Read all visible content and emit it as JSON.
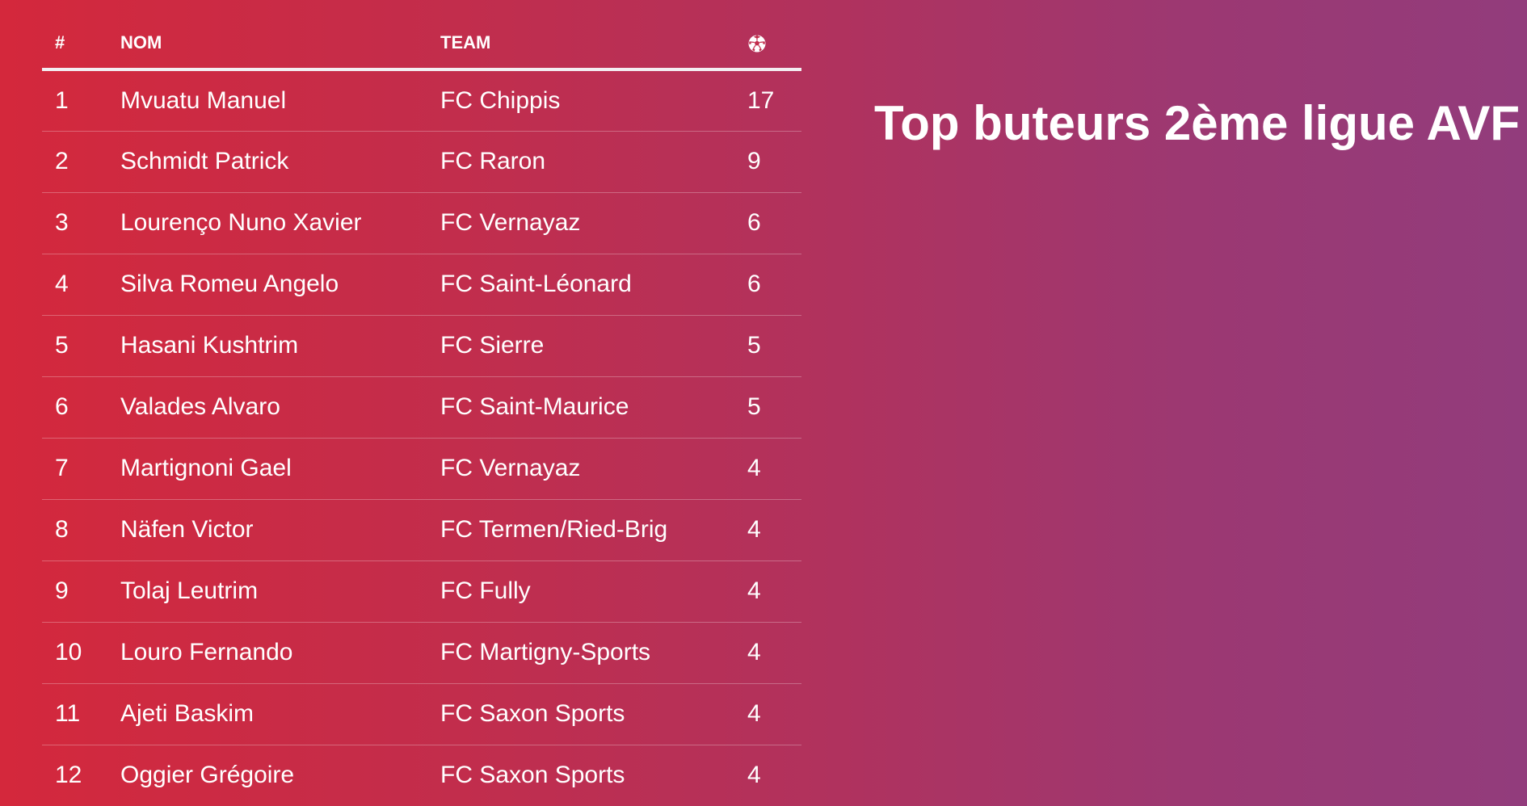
{
  "title": "Top buteurs 2ème ligue AVF",
  "table": {
    "headers": {
      "rank": "#",
      "name": "NOM",
      "team": "TEAM",
      "goals_icon": "soccer-ball-icon"
    },
    "rows": [
      {
        "rank": "1",
        "name": "Mvuatu Manuel",
        "team": "FC Chippis",
        "goals": "17"
      },
      {
        "rank": "2",
        "name": "Schmidt Patrick",
        "team": "FC Raron",
        "goals": "9"
      },
      {
        "rank": "3",
        "name": "Lourenço Nuno Xavier",
        "team": "FC Vernayaz",
        "goals": "6"
      },
      {
        "rank": "4",
        "name": "Silva Romeu Angelo",
        "team": "FC Saint-Léonard",
        "goals": "6"
      },
      {
        "rank": "5",
        "name": "Hasani Kushtrim",
        "team": "FC Sierre",
        "goals": "5"
      },
      {
        "rank": "6",
        "name": "Valades Alvaro",
        "team": "FC Saint-Maurice",
        "goals": "5"
      },
      {
        "rank": "7",
        "name": "Martignoni Gael",
        "team": "FC Vernayaz",
        "goals": "4"
      },
      {
        "rank": "8",
        "name": "Näfen Victor",
        "team": "FC Termen/Ried-Brig",
        "goals": "4"
      },
      {
        "rank": "9",
        "name": "Tolaj Leutrim",
        "team": "FC Fully",
        "goals": "4"
      },
      {
        "rank": "10",
        "name": "Louro Fernando",
        "team": "FC Martigny-Sports",
        "goals": "4"
      },
      {
        "rank": "11",
        "name": "Ajeti Baskim",
        "team": "FC Saxon Sports",
        "goals": "4"
      },
      {
        "rank": "12",
        "name": "Oggier Grégoire",
        "team": "FC Saxon Sports",
        "goals": "4"
      }
    ]
  },
  "colors": {
    "gradient_start": "#d4283c",
    "gradient_end": "#923c7c",
    "text": "#ffffff"
  }
}
